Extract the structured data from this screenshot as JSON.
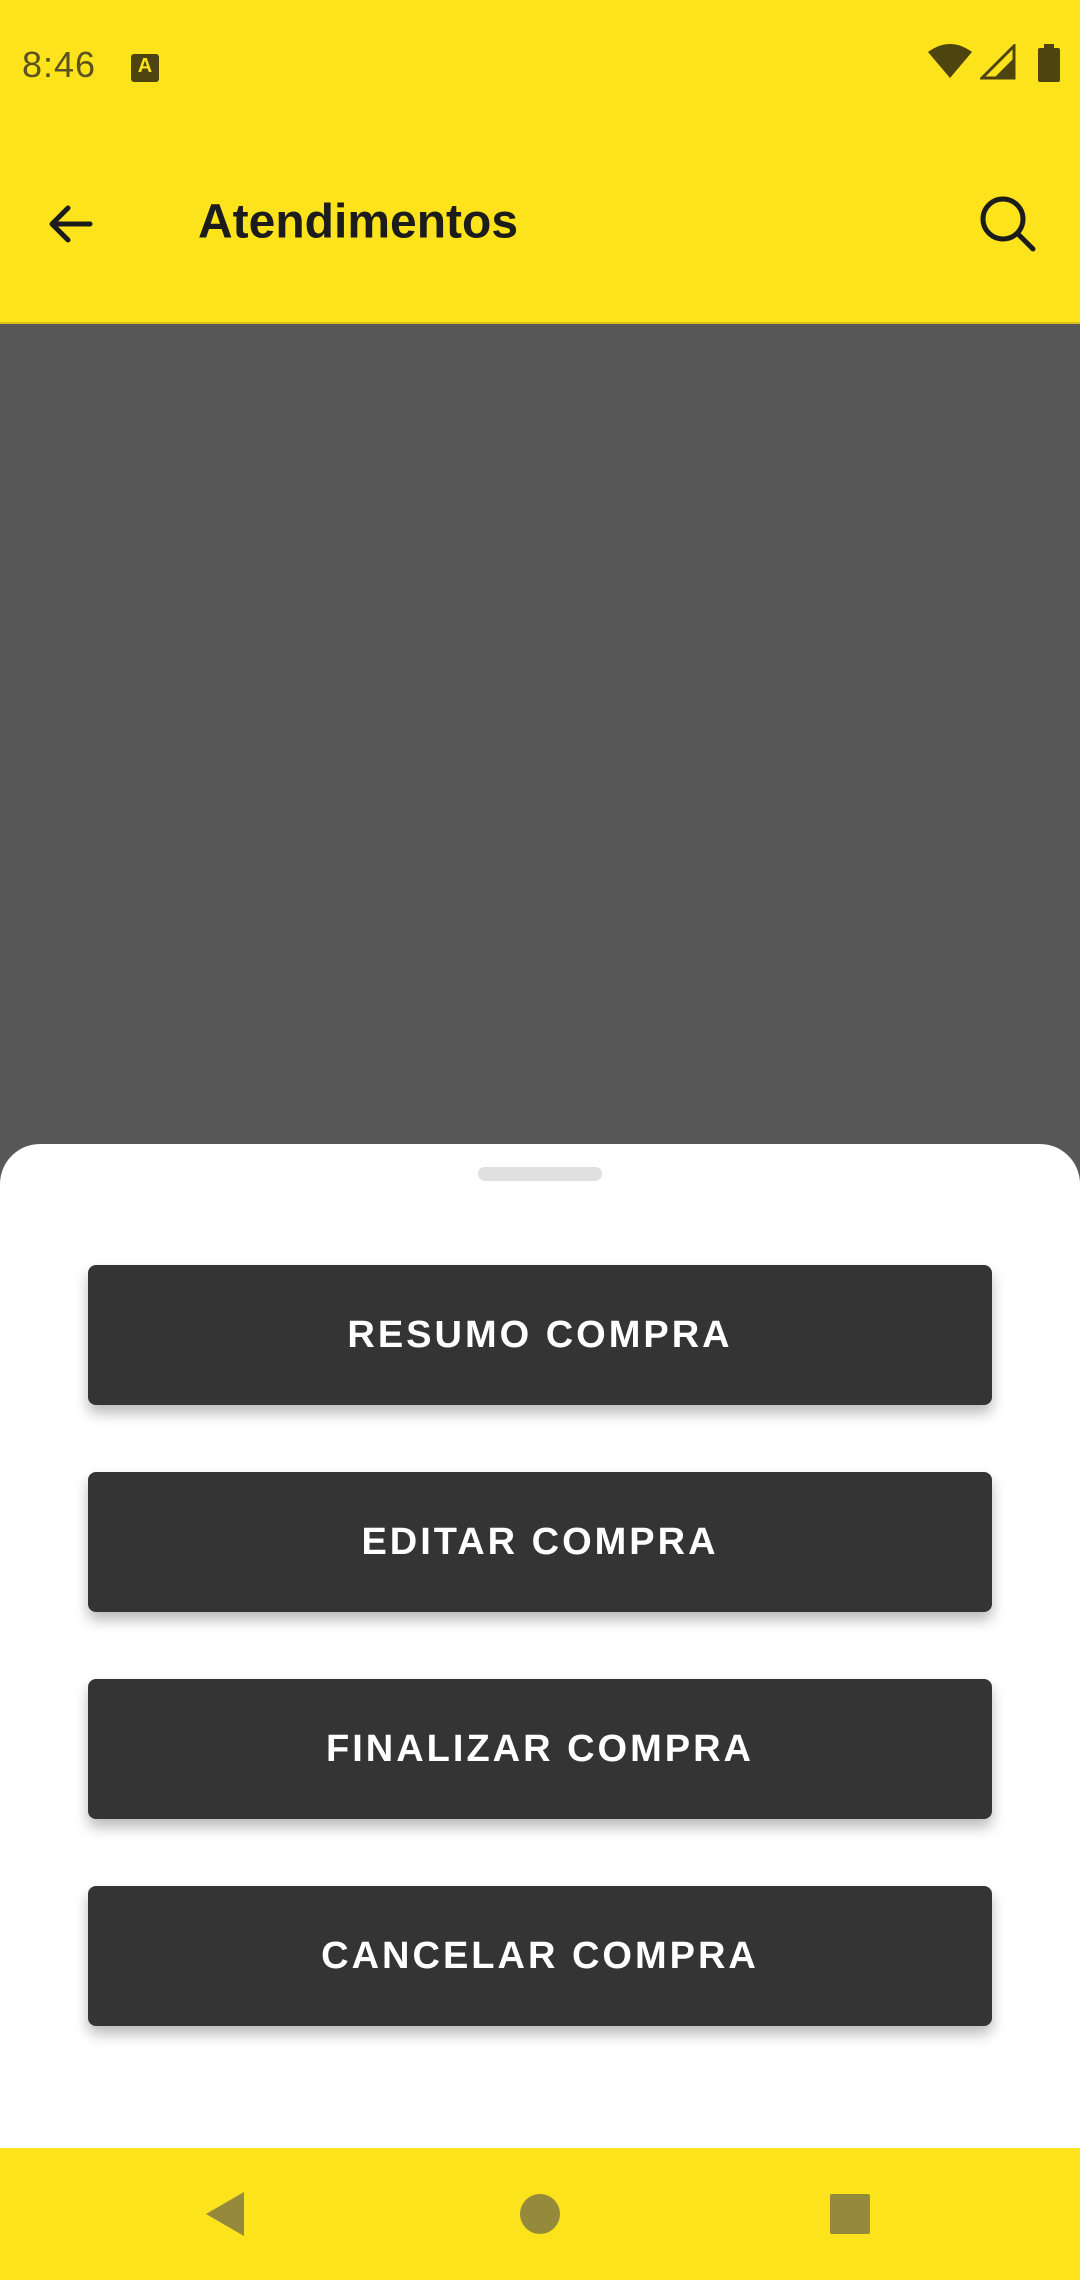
{
  "status_bar": {
    "time": "8:46",
    "notification_icon": "a-icon",
    "notification_letter": "A",
    "icons": [
      "wifi-icon",
      "signal-icon",
      "battery-icon"
    ]
  },
  "app_bar": {
    "title": "Atendimentos",
    "back_icon": "arrow-back-icon",
    "search_icon": "search-icon"
  },
  "bottom_sheet": {
    "buttons": [
      {
        "label": "RESUMO COMPRA"
      },
      {
        "label": "EDITAR COMPRA"
      },
      {
        "label": "FINALIZAR COMPRA"
      },
      {
        "label": "CANCELAR COMPRA"
      }
    ]
  },
  "nav_bar": {
    "items": [
      "back-triangle-icon",
      "home-circle-icon",
      "recents-square-icon"
    ]
  },
  "colors": {
    "primary": "#fde31c",
    "button": "#343434",
    "scrim": "#585858",
    "text_dark": "#1c1c1c"
  }
}
